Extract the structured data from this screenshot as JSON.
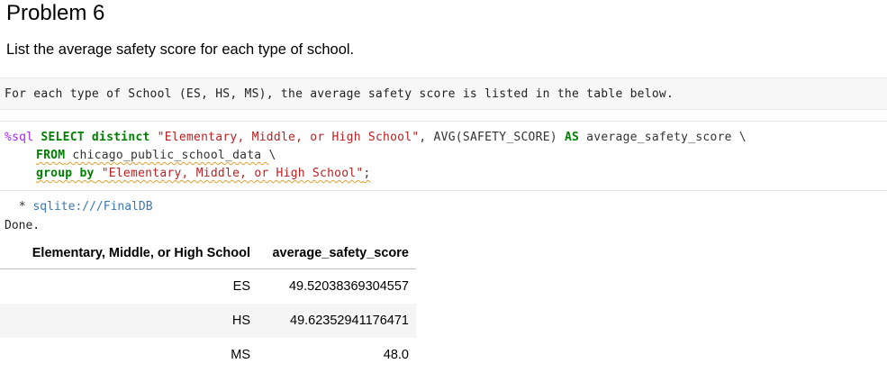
{
  "heading": "Problem 6",
  "description": "List the average safety score for each type of school.",
  "markdown_cell": {
    "text": "For each type of School (ES, HS, MS), the average safety score is listed in the table below."
  },
  "code_cell": {
    "line1": {
      "magic": "%sql ",
      "kw_select": "SELECT",
      "kw_distinct": " distinct ",
      "col_string": "\"Elementary, Middle, or High School\"",
      "mid": ", AVG(SAFETY_SCORE) ",
      "kw_as": "AS",
      "tail": " average_safety_score \\"
    },
    "line2": {
      "kw_from": "FROM",
      "table": " chicago_public_school_data ",
      "cont": "\\"
    },
    "line3": {
      "kw_group": "group by",
      "sp": " ",
      "col_string": "\"Elementary, Middle, or High School\"",
      "end": ";"
    }
  },
  "output": {
    "connection_star": " * ",
    "connection": "sqlite:///FinalDB",
    "status": "Done."
  },
  "result_table": {
    "headers": [
      "Elementary, Middle, or High School",
      "average_safety_score"
    ],
    "rows": [
      [
        "ES",
        "49.52038369304557"
      ],
      [
        "HS",
        "49.62352941176471"
      ],
      [
        "MS",
        "48.0"
      ]
    ]
  }
}
